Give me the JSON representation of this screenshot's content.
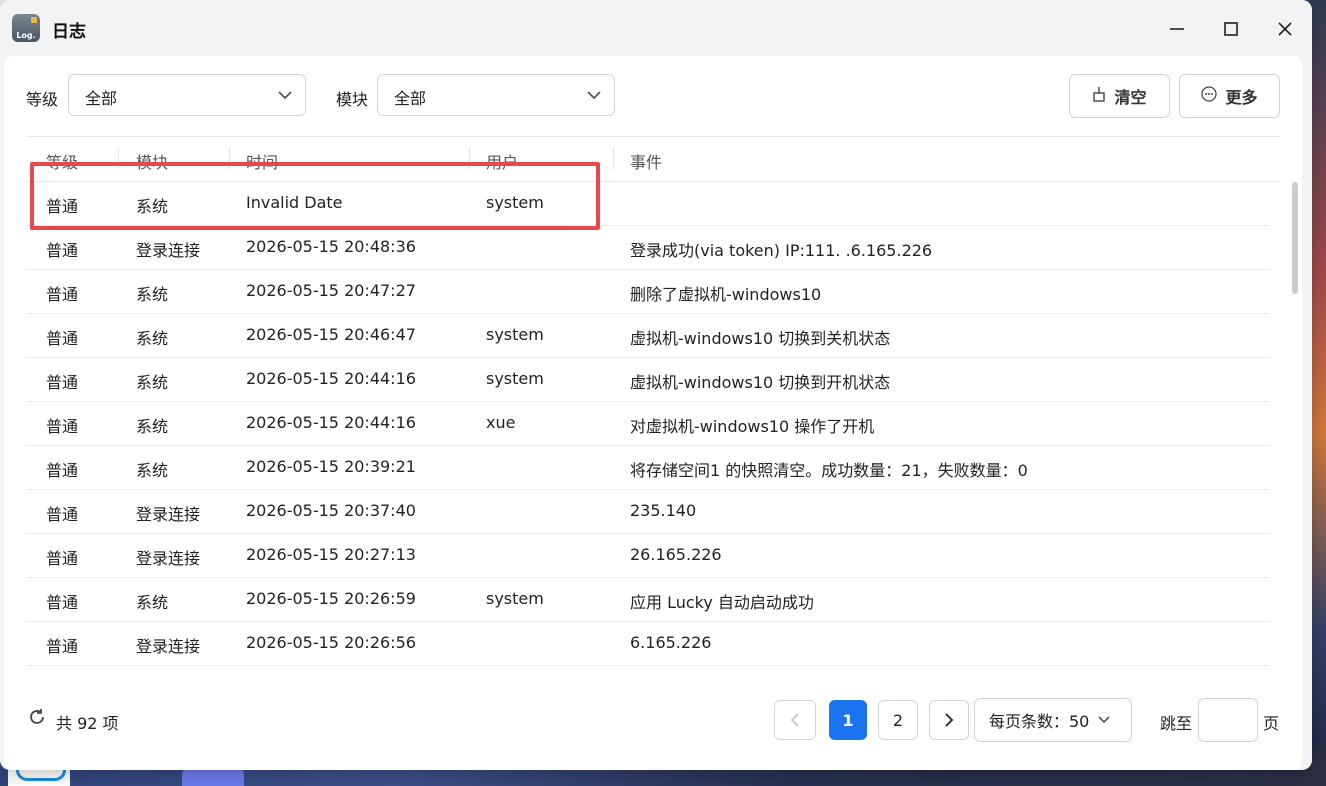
{
  "window": {
    "title": "日志",
    "icon_text": "Log."
  },
  "filters": {
    "level_label": "等级",
    "level_value": "全部",
    "module_label": "模块",
    "module_value": "全部"
  },
  "toolbar": {
    "clear_label": "清空",
    "more_label": "更多"
  },
  "columns": [
    "等级",
    "模块",
    "时间",
    "用户",
    "事件"
  ],
  "rows": [
    {
      "level": "普通",
      "module": "系统",
      "time": "Invalid Date",
      "user": "system",
      "event": ""
    },
    {
      "level": "普通",
      "module": "登录连接",
      "time": "2026-05-15 20:48:36",
      "user": "",
      "event": "登录成功(via token) IP:111.  .6.165.226"
    },
    {
      "level": "普通",
      "module": "系统",
      "time": "2026-05-15 20:47:27",
      "user": "",
      "event": "删除了虚拟机-windows10"
    },
    {
      "level": "普通",
      "module": "系统",
      "time": "2026-05-15 20:46:47",
      "user": "system",
      "event": "虚拟机-windows10 切换到关机状态"
    },
    {
      "level": "普通",
      "module": "系统",
      "time": "2026-05-15 20:44:16",
      "user": "system",
      "event": "虚拟机-windows10 切换到开机状态"
    },
    {
      "level": "普通",
      "module": "系统",
      "time": "2026-05-15 20:44:16",
      "user": "xue",
      "event": "对虚拟机-windows10 操作了开机"
    },
    {
      "level": "普通",
      "module": "系统",
      "time": "2026-05-15 20:39:21",
      "user": "",
      "event": "将存储空间1 的快照清空。成功数量：21，失败数量：0"
    },
    {
      "level": "普通",
      "module": "登录连接",
      "time": "2026-05-15 20:37:40",
      "user": "",
      "event": "235.140"
    },
    {
      "level": "普通",
      "module": "登录连接",
      "time": "2026-05-15 20:27:13",
      "user": "",
      "event": "26.165.226"
    },
    {
      "level": "普通",
      "module": "系统",
      "time": "2026-05-15 20:26:59",
      "user": "system",
      "event": "应用 Lucky 自动启动成功"
    },
    {
      "level": "普通",
      "module": "登录连接",
      "time": "2026-05-15 20:26:56",
      "user": "",
      "event": "6.165.226"
    }
  ],
  "footer": {
    "total": "共 92 项",
    "pages": [
      "1",
      "2"
    ],
    "page_size": "每页条数：50",
    "jump_label": "跳至",
    "page_suffix": "页"
  },
  "colors": {
    "accent": "#1a74f0",
    "highlight": "#e5494d"
  }
}
